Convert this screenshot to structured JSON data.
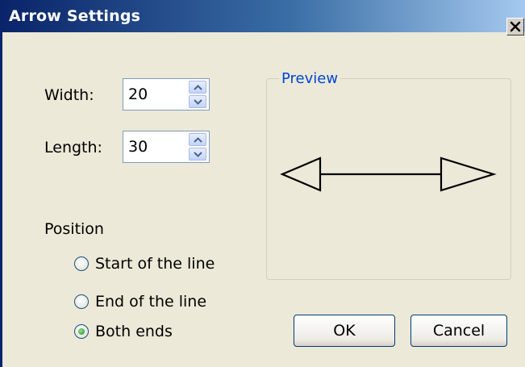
{
  "window": {
    "title": "Arrow Settings"
  },
  "icons": {
    "close": "close-icon",
    "spin_up": "chevron-up-icon",
    "spin_down": "chevron-down-icon"
  },
  "fields": {
    "width": {
      "label": "Width:",
      "value": "20"
    },
    "length": {
      "label": "Length:",
      "value": "30"
    }
  },
  "position": {
    "label": "Position",
    "options": [
      {
        "label": "Start of the line",
        "selected": false
      },
      {
        "label": "End of the line",
        "selected": false
      },
      {
        "label": "Both ends",
        "selected": true
      }
    ]
  },
  "preview": {
    "label": "Preview"
  },
  "buttons": {
    "ok": "OK",
    "cancel": "Cancel"
  },
  "colors": {
    "title_start": "#0a246a",
    "title_end": "#a6caf0",
    "face": "#ece9d8",
    "groupbox_title": "#0046d5"
  }
}
